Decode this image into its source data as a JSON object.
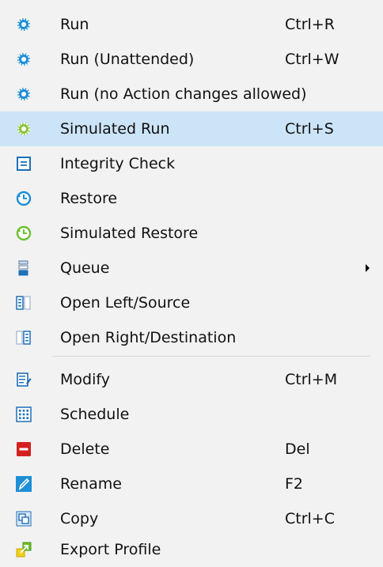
{
  "menu": {
    "items": [
      {
        "label": "Run",
        "shortcut": "Ctrl+R",
        "icon": "gear-icon"
      },
      {
        "label": "Run (Unattended)",
        "shortcut": "Ctrl+W",
        "icon": "gear-icon"
      },
      {
        "label": "Run (no Action changes allowed)",
        "shortcut": "",
        "icon": "gear-icon"
      },
      {
        "label": "Simulated Run",
        "shortcut": "Ctrl+S",
        "icon": "gear-green-icon",
        "highlighted": true
      },
      {
        "label": "Integrity Check",
        "shortcut": "",
        "icon": "integrity-check-icon"
      },
      {
        "label": "Restore",
        "shortcut": "",
        "icon": "clock-icon"
      },
      {
        "label": "Simulated Restore",
        "shortcut": "",
        "icon": "clock-green-icon"
      },
      {
        "label": "Queue",
        "shortcut": "",
        "icon": "queue-icon",
        "submenu": true
      },
      {
        "label": "Open Left/Source",
        "shortcut": "",
        "icon": "open-left-icon"
      },
      {
        "label": "Open Right/Destination",
        "shortcut": "",
        "icon": "open-right-icon"
      },
      {
        "label": "Modify",
        "shortcut": "Ctrl+M",
        "icon": "modify-icon"
      },
      {
        "label": "Schedule",
        "shortcut": "",
        "icon": "schedule-icon"
      },
      {
        "label": "Delete",
        "shortcut": "Del",
        "icon": "delete-icon"
      },
      {
        "label": "Rename",
        "shortcut": "F2",
        "icon": "rename-icon"
      },
      {
        "label": "Copy",
        "shortcut": "Ctrl+C",
        "icon": "copy-icon"
      },
      {
        "label": "Export Profile",
        "shortcut": "",
        "icon": "export-icon"
      }
    ],
    "colors": {
      "highlight": "#cce4f7",
      "background": "#f2f2f2",
      "gear_blue": "#1e8fd6",
      "gear_green": "#8cc63f",
      "delete_red": "#d42020"
    }
  }
}
